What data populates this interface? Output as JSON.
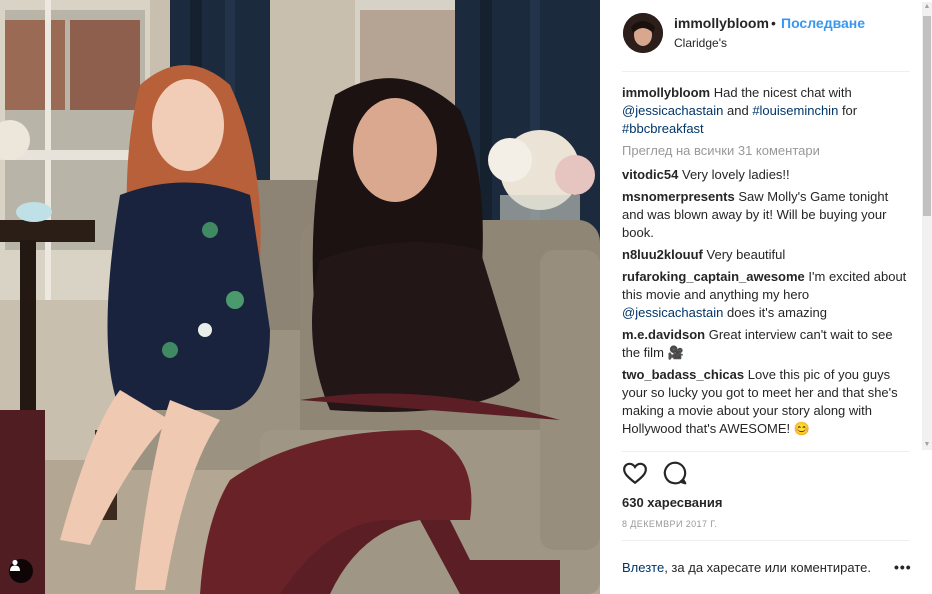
{
  "post": {
    "username": "immollybloom",
    "separator": "•",
    "follow_label": "Последване",
    "location": "Claridge's"
  },
  "caption": {
    "username": "immollybloom",
    "text_1": "Had the nicest chat with",
    "mention_1": "@jessicachastain",
    "text_2": "and",
    "mention_2": "#louiseminchin",
    "text_3": "for",
    "hashtag": "#bbcbreakfast"
  },
  "view_all_comments": "Преглед на всички 31 коментари",
  "comments": [
    {
      "user": "vitodic54",
      "text": "Very lovely ladies!!"
    },
    {
      "user": "msnomerpresents",
      "text": "Saw Molly's Game tonight and was blown away by it! Will be buying your book."
    },
    {
      "user": "n8luu2klouuf",
      "text": "Very beautiful"
    },
    {
      "user": "rufaroking_captain_awesome",
      "text": "I'm excited about this movie and anything my hero",
      "mention": "@jessicachastain",
      "text_after": "does it's amazing"
    },
    {
      "user": "m.e.davidson",
      "text": "Great interview can't wait to see the film 🎥"
    },
    {
      "user": "two_badass_chicas",
      "text": "Love this pic of you guys your so lucky you got to meet her and that she's making a movie about your story along with Hollywood that's AWESOME! 😊"
    }
  ],
  "likes": "630 харесвания",
  "date": "8 ДЕКЕМВРИ 2017 Г.",
  "login": {
    "link": "Влезте",
    "text": ", за да харесате или коментирате.",
    "more": "•••"
  },
  "icons": {
    "like": "heart-icon",
    "comment": "comment-icon",
    "tag": "person-tag-icon",
    "more": "more-options-icon"
  },
  "colors": {
    "link_blue": "#3897f0",
    "mention": "#003569",
    "muted": "#999999"
  }
}
